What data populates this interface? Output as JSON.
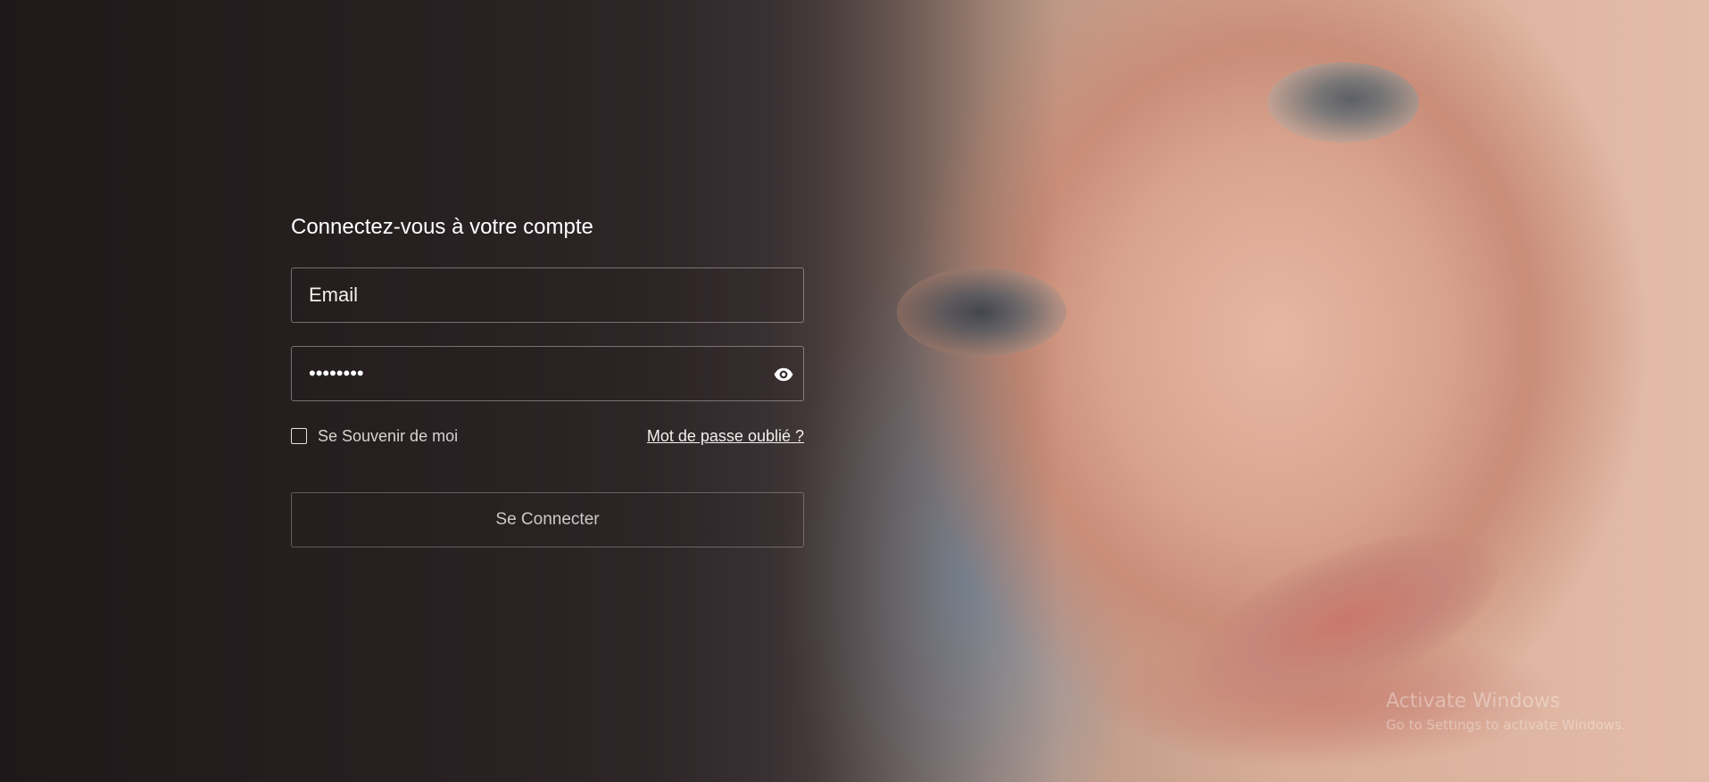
{
  "login": {
    "title": "Connectez-vous à votre compte",
    "email": {
      "placeholder": "Email",
      "value": ""
    },
    "password": {
      "value": "********"
    },
    "remember_label": "Se Souvenir de moi",
    "remember_checked": false,
    "forgot_label": "Mot de passe oublié ?",
    "submit_label": "Se Connecter"
  },
  "icons": {
    "password_toggle": "eye-icon"
  },
  "watermark": {
    "line1": "Activate Windows",
    "line2": "Go to Settings to activate Windows."
  },
  "colors": {
    "text": "#ffffff",
    "border": "#dcd2d2",
    "overlay": "#140e0e"
  }
}
